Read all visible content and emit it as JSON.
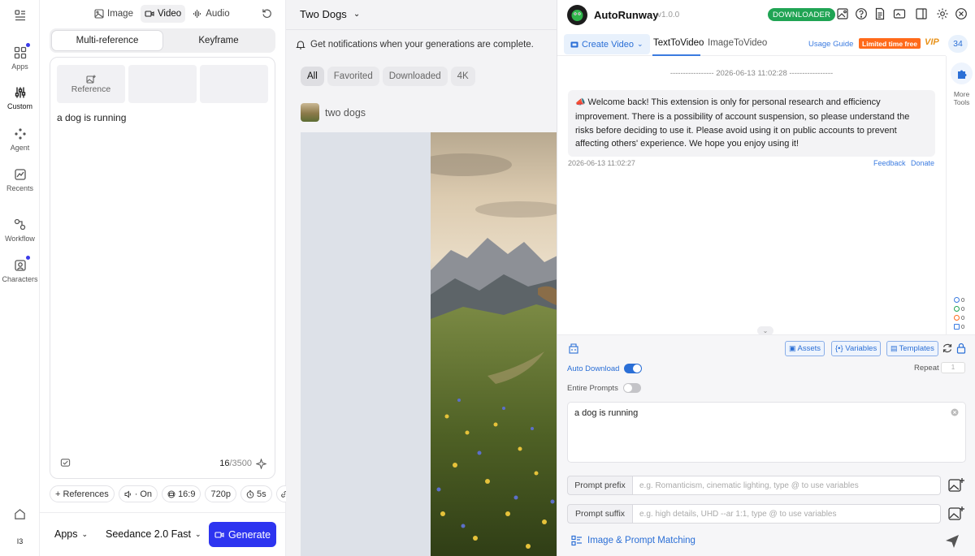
{
  "nav": {
    "apps_label": "Apps",
    "custom_label": "Custom",
    "agent_label": "Agent",
    "recents_label": "Recents",
    "workflow_label": "Workflow",
    "characters_label": "Characters",
    "user_initials": "I3"
  },
  "composer": {
    "mode_tabs": [
      "Image",
      "Video",
      "Audio"
    ],
    "active_mode": "Video",
    "sub_tabs": [
      "Multi-reference",
      "Keyframe"
    ],
    "reference_label": "Reference",
    "prompt": "a dog is running",
    "char_count": "16",
    "char_max": "/3500",
    "params": {
      "references": "References",
      "audio": "On",
      "ratio": "16:9",
      "resolution": "720p",
      "duration": "5s"
    },
    "footer": {
      "apps": "Apps",
      "model": "Seedance 2.0 Fast",
      "generate": "Generate"
    }
  },
  "main": {
    "title": "Two Dogs",
    "notification": "Get notifications when your generations are complete.",
    "filters": [
      "All",
      "Favorited",
      "Downloaded",
      "4K"
    ],
    "active_filter": "All",
    "generation_title": "two dogs"
  },
  "extension": {
    "brand": "AutoRunway",
    "version": "v1.0.0",
    "downloader_badge": "DOWNLOADER",
    "create_video": "Create Video",
    "tabs": [
      "TextToVideo",
      "ImageToVideo"
    ],
    "active_tab": "TextToVideo",
    "usage_guide": "Usage Guide",
    "limited": "Limited time free",
    "vip": "VIP",
    "counter": "34",
    "more_tools": "More Tools",
    "log_separator": "----------------- 2026-06-13 11:02:28 -----------------",
    "welcome_message": "Welcome back! This extension is only for personal research and efficiency improvement. There is a possibility of account suspension, so please understand the risks before deciding to use it. Please avoid using it on public accounts to prevent affecting others' experience. We hope you enjoy using it!",
    "message_time": "2026-06-13 11:02:27",
    "feedback": "Feedback",
    "donate": "Donate",
    "stats": [
      "0",
      "0",
      "0",
      "0"
    ],
    "assets": "Assets",
    "variables": "{•} Variables",
    "templates": "Templates",
    "auto_download": "Auto Download",
    "entire_prompts": "Entire Prompts",
    "repeat_label": "Repeat",
    "repeat_value": "1",
    "prompt": "a dog is running",
    "prefix_label": "Prompt prefix",
    "prefix_placeholder": "e.g. Romanticism, cinematic lighting, type @ to use variables",
    "suffix_label": "Prompt suffix",
    "suffix_placeholder": "e.g. high details, UHD --ar 1:1, type @ to use variables",
    "matching": "Image & Prompt Matching"
  },
  "colors": {
    "generate_button": "#2d34f0",
    "downloader_badge": "#20a454",
    "limited_badge": "#ff6a1a",
    "link_blue": "#2b6fd6"
  }
}
